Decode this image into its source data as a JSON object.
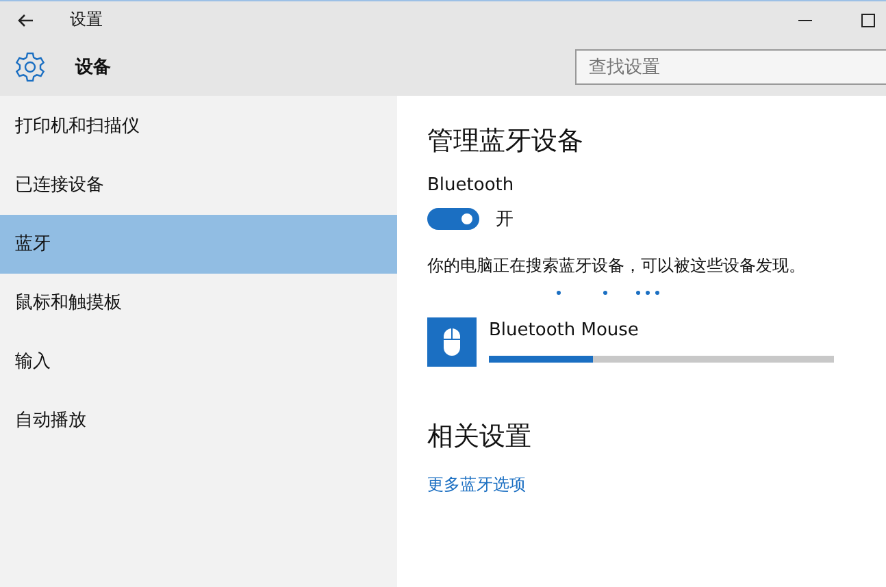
{
  "window": {
    "title": "设置"
  },
  "header": {
    "title": "设备",
    "search": {
      "placeholder": "查找设置"
    }
  },
  "sidebar": {
    "items": [
      {
        "label": "打印机和扫描仪",
        "selected": false
      },
      {
        "label": "已连接设备",
        "selected": false
      },
      {
        "label": "蓝牙",
        "selected": true
      },
      {
        "label": "鼠标和触摸板",
        "selected": false
      },
      {
        "label": "输入",
        "selected": false
      },
      {
        "label": "自动播放",
        "selected": false
      }
    ]
  },
  "content": {
    "heading": "管理蓝牙设备",
    "bluetooth": {
      "label": "Bluetooth",
      "on": true,
      "state_text": "开"
    },
    "status": "你的电脑正在搜索蓝牙设备，可以被这些设备发现。",
    "devices": [
      {
        "name": "Bluetooth Mouse",
        "level": 0.3
      }
    ],
    "related": {
      "heading": "相关设置",
      "link": "更多蓝牙选项"
    }
  }
}
